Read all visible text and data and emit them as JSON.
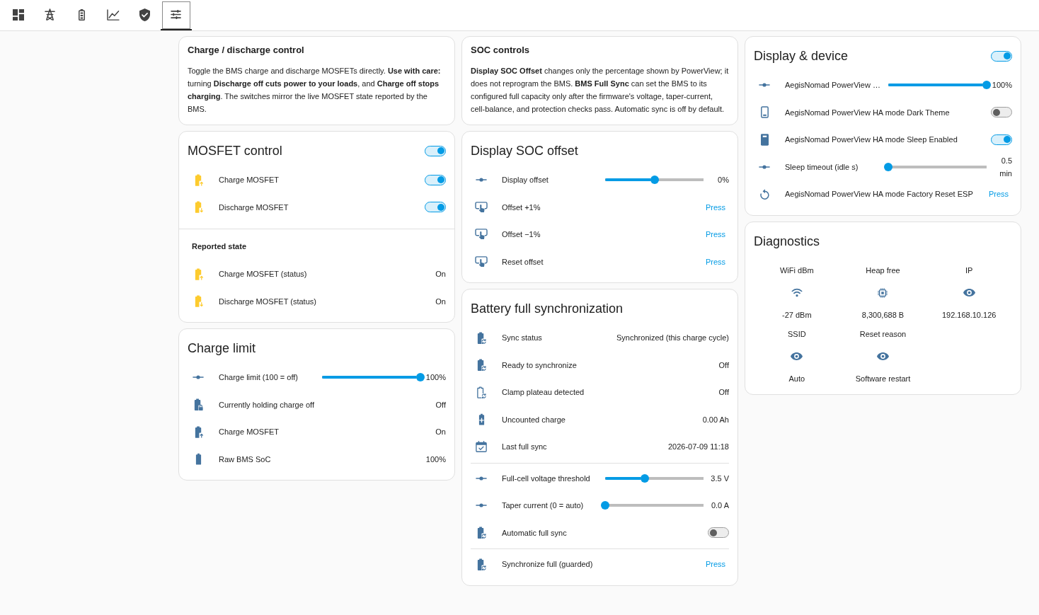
{
  "toolbar": {
    "tabs": [
      {
        "selected": false
      },
      {
        "selected": false
      },
      {
        "selected": false
      },
      {
        "selected": false
      },
      {
        "selected": false
      },
      {
        "selected": true
      }
    ]
  },
  "columns": [
    {
      "cards": [
        {
          "kind": "markdown",
          "title": "Charge / discharge control",
          "text": "Toggle the BMS charge and discharge MOSFETs directly. **Use with care:** turning **Discharge off cuts power to your loads**, and **Charge off stops charging**. The switches mirror the live MOSFET state reported by the BMS."
        },
        {
          "kind": "entities",
          "title": "MOSFET control",
          "header_toggle": {
            "on": true
          },
          "rows": [
            {
              "kind": "toggle",
              "label": "Charge MOSFET",
              "active": true,
              "on": true
            },
            {
              "kind": "toggle",
              "label": "Discharge MOSFET",
              "active": true,
              "on": true
            },
            {
              "kind": "section",
              "label": "Reported state"
            },
            {
              "kind": "value",
              "label": "Charge MOSFET (status)",
              "active": true,
              "value": "On"
            },
            {
              "kind": "value",
              "label": "Discharge MOSFET (status)",
              "active": true,
              "value": "On"
            }
          ]
        },
        {
          "kind": "entities",
          "title": "Charge limit",
          "rows": [
            {
              "kind": "slider",
              "label": "Charge limit (100 = off)",
              "active": false,
              "level": 1,
              "reading": "100%"
            },
            {
              "kind": "value",
              "label": "Currently holding charge off",
              "active": false,
              "value": "Off"
            },
            {
              "kind": "value",
              "label": "Charge MOSFET",
              "active": false,
              "value": "On"
            },
            {
              "kind": "value",
              "label": "Raw BMS SoC",
              "active": false,
              "value": "100%"
            }
          ]
        }
      ]
    },
    {
      "cards": [
        {
          "kind": "markdown",
          "title": "SOC controls",
          "text": "**Display SOC Offset** changes only the percentage shown by PowerView; it does not reprogram the BMS. **BMS Full Sync** can set the BMS to its configured full capacity only after the firmware's voltage, taper-current, cell-balance, and protection checks pass. Automatic sync is off by default."
        },
        {
          "kind": "entities",
          "title": "Display SOC offset",
          "rows": [
            {
              "kind": "slider",
              "label": "Display offset",
              "active": false,
              "level": 0.5,
              "reading": "0%"
            },
            {
              "kind": "button",
              "label": "Offset +1%",
              "active": false,
              "action": "Press"
            },
            {
              "kind": "button",
              "label": "Offset −1%",
              "active": false,
              "action": "Press"
            },
            {
              "kind": "button",
              "label": "Reset offset",
              "active": false,
              "action": "Press"
            }
          ]
        },
        {
          "kind": "entities",
          "title": "Battery full synchronization",
          "rows": [
            {
              "kind": "value",
              "label": "Sync status",
              "active": false,
              "value": "Synchronized (this charge cycle)"
            },
            {
              "kind": "value",
              "label": "Ready to synchronize",
              "active": false,
              "value": "Off"
            },
            {
              "kind": "value",
              "label": "Clamp plateau detected",
              "active": false,
              "value": "Off"
            },
            {
              "kind": "value",
              "label": "Uncounted charge",
              "active": false,
              "value": "0.00 Ah"
            },
            {
              "kind": "value",
              "label": "Last full sync",
              "active": false,
              "value": "2026-07-09 11:18"
            },
            {
              "kind": "divider"
            },
            {
              "kind": "slider",
              "label": "Full-cell voltage threshold",
              "active": false,
              "level": 0.4,
              "reading": "3.5 V"
            },
            {
              "kind": "slider",
              "label": "Taper current (0 = auto)",
              "active": false,
              "level": 0,
              "reading": "0.0 A"
            },
            {
              "kind": "toggle",
              "label": "Automatic full sync",
              "active": false,
              "on": false
            },
            {
              "kind": "divider"
            },
            {
              "kind": "button",
              "label": "Synchronize full (guarded)",
              "active": false,
              "action": "Press"
            }
          ]
        }
      ]
    },
    {
      "cards": [
        {
          "kind": "entities",
          "title": "Display & device",
          "header_toggle": {
            "on": true
          },
          "rows": [
            {
              "kind": "slider",
              "label": "AegisNomad PowerView …",
              "active": false,
              "level": 1,
              "reading": "100%"
            },
            {
              "kind": "toggle",
              "label": "AegisNomad PowerView HA mode Dark Theme",
              "active": false,
              "on": false
            },
            {
              "kind": "toggle",
              "label": "AegisNomad PowerView HA mode Sleep Enabled",
              "active": false,
              "on": true
            },
            {
              "kind": "slider",
              "label": "Sleep timeout (idle s)",
              "active": false,
              "level": 0,
              "reading": "0.5 min"
            },
            {
              "kind": "button",
              "label": "AegisNomad PowerView HA mode Factory Reset ESP",
              "active": false,
              "action": "Press"
            }
          ]
        },
        {
          "kind": "glance",
          "title": "Diagnostics",
          "items": [
            {
              "name": "WiFi dBm",
              "value": "-27 dBm"
            },
            {
              "name": "Heap free",
              "value": "8,300,688 B"
            },
            {
              "name": "IP",
              "value": "192.168.10.126"
            },
            {
              "name": "SSID",
              "value": "Auto"
            },
            {
              "name": "Reset reason",
              "value": "Software restart"
            }
          ]
        }
      ]
    }
  ]
}
